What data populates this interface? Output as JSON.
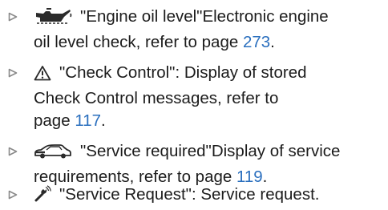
{
  "items": [
    {
      "icon": "oil-can-icon",
      "lines": [
        {
          "pre": "\"Engine oil level\"Electronic engine",
          "link": "",
          "post": ""
        },
        {
          "pre": "oil level check, refer to page ",
          "link": "273",
          "post": "."
        }
      ]
    },
    {
      "icon": "warning-triangle-icon",
      "lines": [
        {
          "pre": "\"Check Control\": Display of stored",
          "link": "",
          "post": ""
        },
        {
          "pre": "Check Control messages, refer to",
          "link": "",
          "post": ""
        },
        {
          "pre": "page ",
          "link": "117",
          "post": "."
        }
      ]
    },
    {
      "icon": "car-service-icon",
      "lines": [
        {
          "pre": "\"Service required\"Display of service",
          "link": "",
          "post": ""
        },
        {
          "pre": "requirements, refer to page ",
          "link": "119",
          "post": "."
        }
      ]
    },
    {
      "icon": "wrench-signal-icon",
      "lines": [
        {
          "pre": "\"Service Request\": Service request.",
          "link": "",
          "post": ""
        }
      ]
    }
  ],
  "colors": {
    "text": "#1c1c1c",
    "link": "#2a6fbe",
    "bullet": "#8a8a8a"
  }
}
